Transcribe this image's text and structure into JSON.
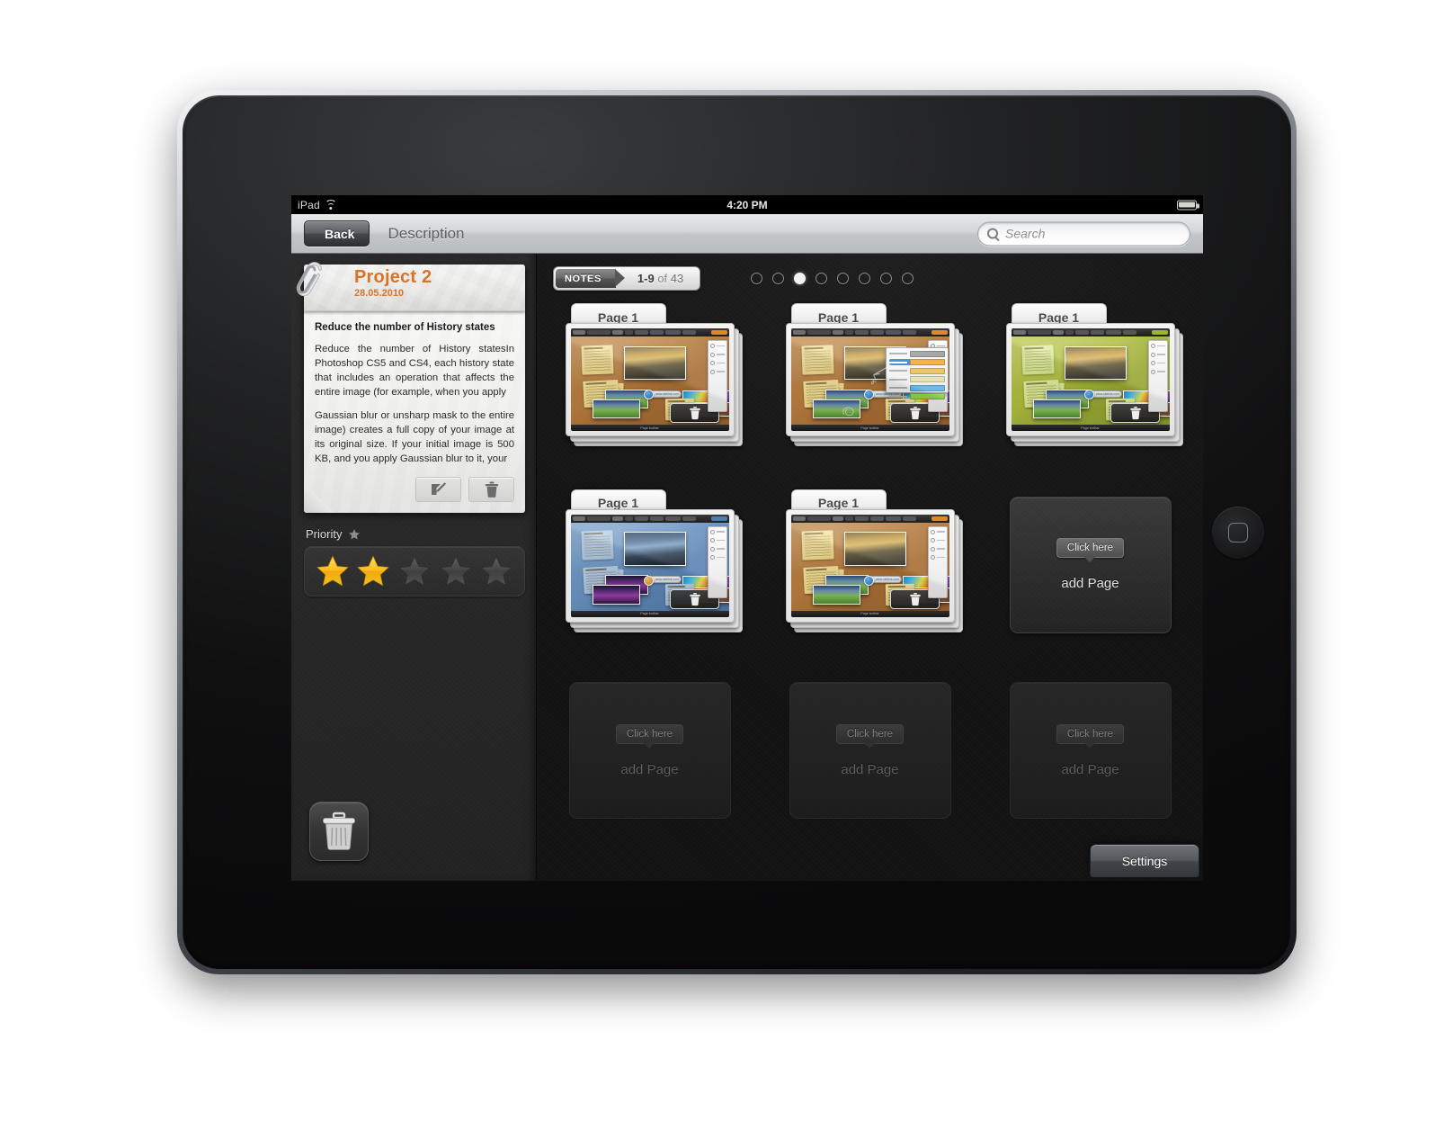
{
  "statusbar": {
    "carrier": "iPad",
    "wifi_icon": "wifi-icon",
    "time": "4:20 PM",
    "battery_icon": "battery-full-icon"
  },
  "navbar": {
    "back_label": "Back",
    "title": "Description",
    "search": {
      "placeholder": "Search",
      "value": "",
      "icon": "search-icon"
    }
  },
  "sidebar": {
    "note": {
      "title": "Project 2",
      "date": "28.05.2010",
      "heading": "Reduce the number of History states",
      "paragraph_1": "Reduce the number of History statesIn Photoshop CS5 and CS4, each history state that includes an operation that affects the entire image (for example, when you apply",
      "paragraph_2": "Gaussian blur or unsharp mask to the entire image) creates a full copy of your image at its original size. If your initial image is 500 KB, and you apply Gaussian blur to it, your",
      "edit_icon": "edit-pencil-icon",
      "delete_icon": "trash-icon",
      "clip_icon": "paperclip-icon"
    },
    "priority": {
      "label": "Priority",
      "label_icon": "star-icon",
      "rating": 2,
      "max": 5,
      "star_filled_color": "#f5b21c",
      "star_empty_color": "#4a4a4a"
    },
    "trash_icon": "trash-can-icon"
  },
  "pane": {
    "pager": {
      "tag": "NOTES",
      "range": "1-9",
      "of_word": "of",
      "total": "43"
    },
    "dots": {
      "count": 8,
      "active_index": 2
    },
    "pages": [
      {
        "tab_label": "Page 1",
        "board": "cork",
        "variant": "a"
      },
      {
        "tab_label": "Page 1",
        "board": "cork",
        "variant": "b"
      },
      {
        "tab_label": "Page 1",
        "board": "green",
        "variant": "a"
      },
      {
        "tab_label": "Page 1",
        "board": "blue",
        "variant": "a"
      },
      {
        "tab_label": "Page 1",
        "board": "cork",
        "variant": "a"
      }
    ],
    "add_pages": [
      {
        "button_label": "Click here",
        "label": "add Page",
        "enabled": true
      },
      {
        "button_label": "Click here",
        "label": "add Page",
        "enabled": false
      },
      {
        "button_label": "Click here",
        "label": "add Page",
        "enabled": false
      },
      {
        "button_label": "Click here",
        "label": "add Page",
        "enabled": false
      }
    ],
    "settings_label": "Settings"
  },
  "mini_board": {
    "note_label": "Note 1",
    "image_label": "Image name",
    "web_url": "www.sitelink.com",
    "footer_label": "Page toolbar"
  },
  "colors": {
    "accent_orange": "#d9732a",
    "star_gold": "#f5b21c",
    "screen_bg": "#1a1a1a"
  }
}
